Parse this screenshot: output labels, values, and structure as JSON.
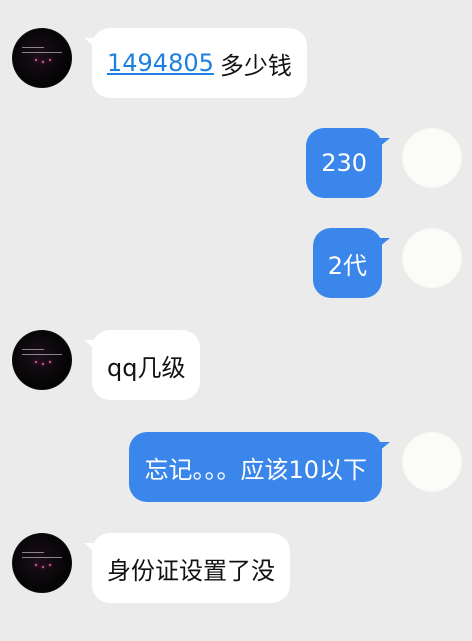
{
  "messages": [
    {
      "side": "left",
      "parts": [
        {
          "text": "1494805",
          "link": true
        },
        {
          "text": "多少钱",
          "link": false
        }
      ]
    },
    {
      "side": "right",
      "parts": [
        {
          "text": "230",
          "link": false
        }
      ]
    },
    {
      "side": "right",
      "parts": [
        {
          "text": "2代",
          "link": false
        }
      ]
    },
    {
      "side": "left",
      "parts": [
        {
          "text": "qq几级",
          "link": false
        }
      ]
    },
    {
      "side": "right",
      "parts": [
        {
          "text": "忘记。。。应该10以下",
          "link": false
        }
      ]
    },
    {
      "side": "left",
      "parts": [
        {
          "text": "身份证设置了没",
          "link": false
        }
      ]
    }
  ],
  "colors": {
    "background": "#ebebeb",
    "incoming_bubble": "#ffffff",
    "outgoing_bubble": "#3b86ea",
    "link": "#1d7fe0"
  }
}
